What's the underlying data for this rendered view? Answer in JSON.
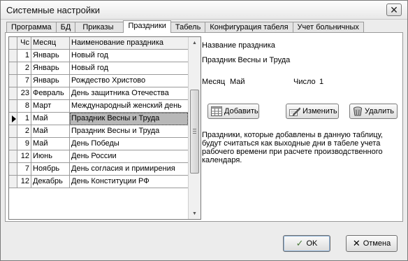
{
  "window": {
    "title": "Системные настройки",
    "close_glyph": "✕"
  },
  "tabs": [
    {
      "label": "Программа"
    },
    {
      "label": "БД"
    },
    {
      "label": "Приказы"
    },
    {
      "label": "Праздники"
    },
    {
      "label": "Табель"
    },
    {
      "label": "Конфигурация табеля"
    },
    {
      "label": "Учет больничных"
    }
  ],
  "active_tab": "Праздники",
  "grid": {
    "columns": {
      "num": "Чс",
      "month": "Месяц",
      "name": "Наименование праздника"
    },
    "rows": [
      {
        "num": "1",
        "month": "Январь",
        "name": "Новый год"
      },
      {
        "num": "2",
        "month": "Январь",
        "name": "Новый год"
      },
      {
        "num": "7",
        "month": "Январь",
        "name": "Рождество Христово"
      },
      {
        "num": "23",
        "month": "Февраль",
        "name": "День защитника Отечества"
      },
      {
        "num": "8",
        "month": "Март",
        "name": "Международный женский день"
      },
      {
        "num": "1",
        "month": "Май",
        "name": "Праздник Весны и Труда"
      },
      {
        "num": "2",
        "month": "Май",
        "name": "Праздник Весны и Труда"
      },
      {
        "num": "9",
        "month": "Май",
        "name": "День Победы"
      },
      {
        "num": "12",
        "month": "Июнь",
        "name": "День России"
      },
      {
        "num": "7",
        "month": "Ноябрь",
        "name": "День согласия и примирения"
      },
      {
        "num": "12",
        "month": "Декабрь",
        "name": "День Конституции РФ"
      }
    ],
    "selected_row": 5
  },
  "details": {
    "name_label": "Название праздника",
    "name_value": "Праздник Весны и Труда",
    "month_label": "Месяц",
    "month_value": "Май",
    "day_label": "Число",
    "day_value": "1"
  },
  "actions": {
    "add": "Добавить",
    "edit": "Изменить",
    "delete": "Удалить"
  },
  "info_text": "Праздники, которые добавлены в данную таблицу, будут считаться как выходные дни в табеле учета рабочего времени при расчете производственного календаря.",
  "footer": {
    "ok": "OK",
    "cancel": "Отмена",
    "ok_icon": "✓",
    "cancel_icon": "✕"
  },
  "icons": {
    "add": "table-add-icon",
    "edit": "pencil-edit-icon",
    "delete": "trash-delete-icon"
  }
}
